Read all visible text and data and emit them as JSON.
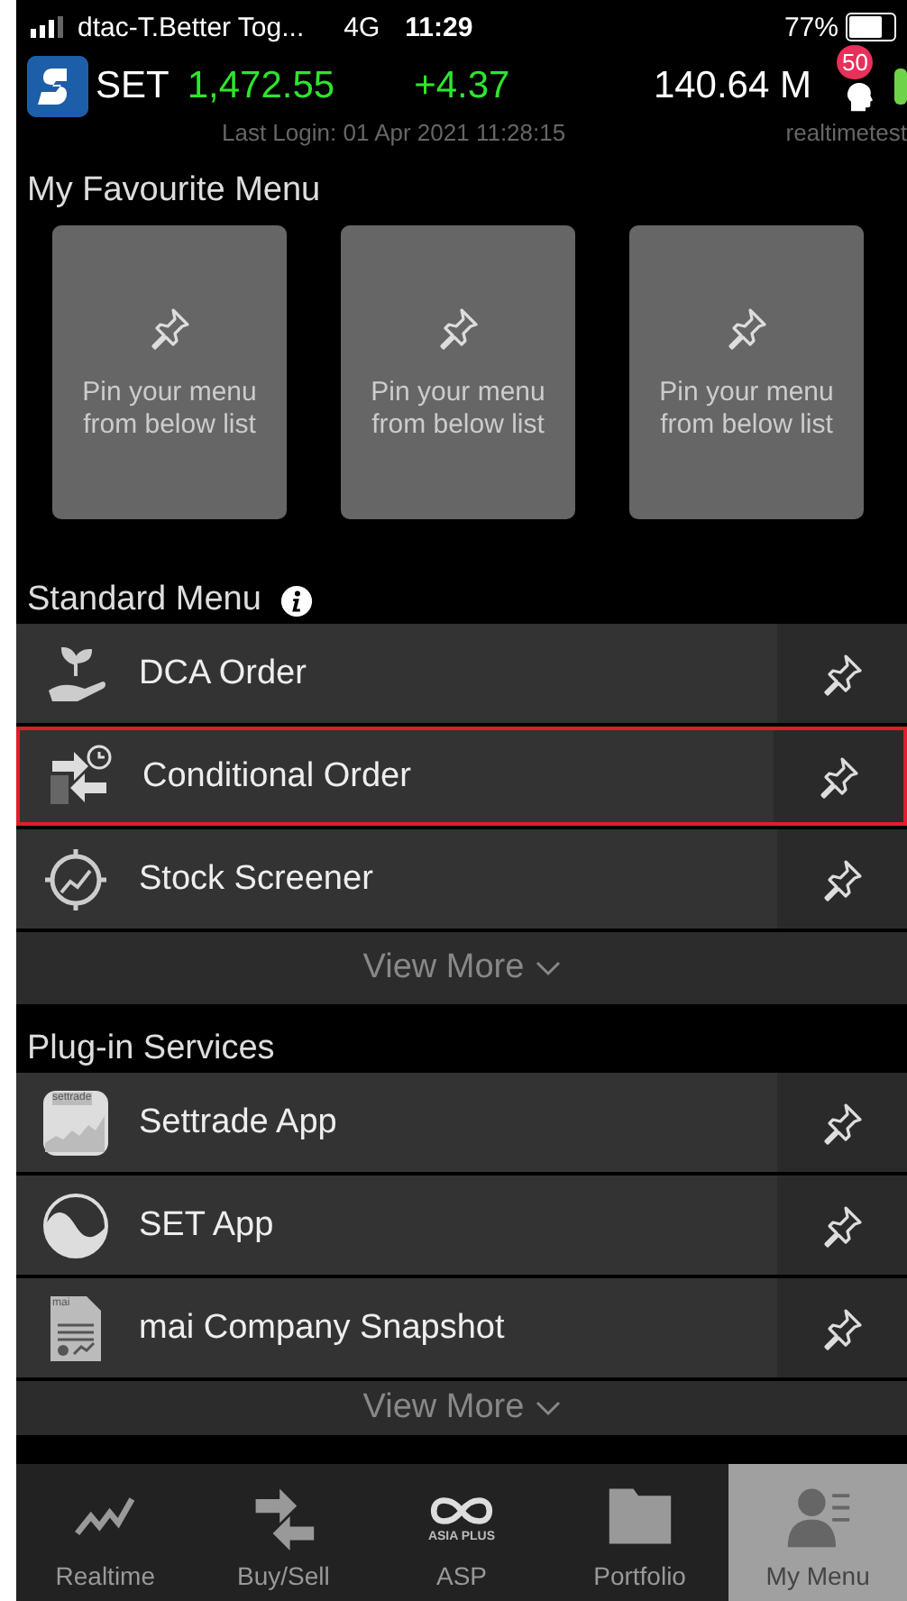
{
  "status_bar": {
    "carrier": "dtac-T.Better Tog...",
    "network": "4G",
    "time": "11:29",
    "battery": "77%"
  },
  "header": {
    "index_name": "SET",
    "index_value": "1,472.55",
    "change": "+4.37",
    "volume": "140.64 M",
    "notification_count": "50",
    "last_login": "Last Login: 01 Apr 2021 11:28:15",
    "user": "realtimetest"
  },
  "favourite_menu": {
    "title": "My Favourite Menu",
    "slots": [
      {
        "text": "Pin your menu from below list"
      },
      {
        "text": "Pin your menu from below list"
      },
      {
        "text": "Pin your menu from below list"
      }
    ]
  },
  "standard_menu": {
    "title": "Standard Menu",
    "items": [
      {
        "label": "DCA Order",
        "kind": "plant",
        "highlighted": false
      },
      {
        "label": "Conditional Order",
        "kind": "arrows",
        "highlighted": true
      },
      {
        "label": "Stock Screener",
        "kind": "screener",
        "highlighted": false
      }
    ],
    "view_more": "View More"
  },
  "plugin_services": {
    "title": "Plug-in Services",
    "items": [
      {
        "label": "Settrade App",
        "kind": "settrade",
        "icon_text": "settrade",
        "highlighted": false
      },
      {
        "label": "SET App",
        "kind": "wave",
        "highlighted": false
      },
      {
        "label": "mai Company Snapshot",
        "kind": "doc",
        "icon_text": "mai",
        "highlighted": false
      }
    ],
    "view_more": "View More"
  },
  "tabs": [
    {
      "label": "Realtime",
      "kind": "chart",
      "selected": false
    },
    {
      "label": "Buy/Sell",
      "kind": "arrows",
      "selected": false
    },
    {
      "label": "ASP",
      "kind": "logo",
      "icon_text": "ASIA PLUS",
      "selected": false
    },
    {
      "label": "Portfolio",
      "kind": "folder",
      "selected": false
    },
    {
      "label": "My Menu",
      "kind": "person",
      "selected": true
    }
  ]
}
